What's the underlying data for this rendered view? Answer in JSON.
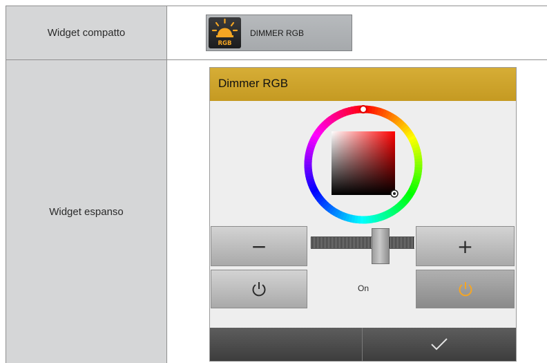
{
  "rows": [
    {
      "label": "Widget compatto"
    },
    {
      "label": "Widget espanso"
    }
  ],
  "compact_widget": {
    "icon": "rgb-bulb-icon",
    "icon_text": "RGB",
    "label": "DIMMER RGB",
    "icon_color": "#f5a623"
  },
  "expanded_widget": {
    "title": "Dimmer RGB",
    "header_color": "#cfa52e",
    "color_picker": {
      "hue_selector_icon": "hue-handle-icon",
      "sv_selector_icon": "sv-handle-icon",
      "selected_hue": "#ff0000"
    },
    "brightness": {
      "decrease_symbol": "−",
      "increase_symbol": "+",
      "level": 0.6
    },
    "power": {
      "off_icon": "power-icon",
      "on_icon": "power-icon",
      "on_color": "#f5a623",
      "state": "On"
    },
    "footer": {
      "confirm_icon": "checkmark-icon"
    }
  }
}
